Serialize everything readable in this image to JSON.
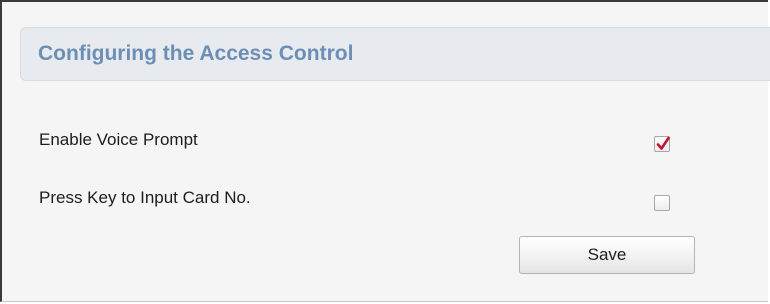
{
  "panel": {
    "title": "Configuring the Access Control"
  },
  "settings": [
    {
      "label": "Enable Voice Prompt",
      "checked": true
    },
    {
      "label": "Press Key to Input Card No.",
      "checked": false
    }
  ],
  "actions": {
    "save_label": "Save"
  },
  "colors": {
    "title": "#6d8fb6",
    "checkmark": "#c8102e",
    "header_bg": "#e7eaee"
  }
}
